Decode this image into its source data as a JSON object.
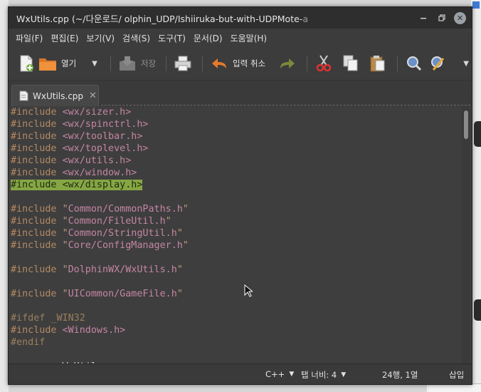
{
  "window": {
    "title_main": "WxUtils.cpp (~/다운로드/  olphin_UDP/Ishiiruka-but-with-UDPMote-",
    "title_fade": "a"
  },
  "menu": [
    "파일(F)",
    "편집(E)",
    "보기(V)",
    "검색(S)",
    "도구(T)",
    "문서(D)",
    "도움말(H)"
  ],
  "toolbar": {
    "open_label": "열기",
    "save_label": "저장",
    "undo_label": "입력 취소"
  },
  "tab": {
    "label": "WxUtils.cpp"
  },
  "code_lines": [
    {
      "type": "inc_angle",
      "kw": "#include",
      "path": "<wx/sizer.h>"
    },
    {
      "type": "inc_angle",
      "kw": "#include",
      "path": "<wx/spinctrl.h>"
    },
    {
      "type": "inc_angle",
      "kw": "#include",
      "path": "<wx/toolbar.h>"
    },
    {
      "type": "inc_angle",
      "kw": "#include",
      "path": "<wx/toplevel.h>"
    },
    {
      "type": "inc_angle",
      "kw": "#include",
      "path": "<wx/utils.h>"
    },
    {
      "type": "inc_angle",
      "kw": "#include",
      "path": "<wx/window.h>"
    },
    {
      "type": "inc_angle_hl",
      "kw": "#include",
      "path": "<wx/display.h>"
    },
    {
      "type": "blank"
    },
    {
      "type": "inc_quote",
      "kw": "#include",
      "path": "Common/CommonPaths.h"
    },
    {
      "type": "inc_quote",
      "kw": "#include",
      "path": "Common/FileUtil.h"
    },
    {
      "type": "inc_quote",
      "kw": "#include",
      "path": "Common/StringUtil.h"
    },
    {
      "type": "inc_quote",
      "kw": "#include",
      "path": "Core/ConfigManager.h"
    },
    {
      "type": "blank"
    },
    {
      "type": "inc_quote",
      "kw": "#include",
      "path": "DolphinWX/WxUtils.h"
    },
    {
      "type": "blank"
    },
    {
      "type": "inc_quote",
      "kw": "#include",
      "path": "UICommon/GameFile.h"
    },
    {
      "type": "blank"
    },
    {
      "type": "pp",
      "text": "#ifdef _WIN32"
    },
    {
      "type": "inc_angle",
      "kw": "#include",
      "path": "<Windows.h>"
    },
    {
      "type": "pp",
      "text": "#endif"
    },
    {
      "type": "blank"
    },
    {
      "type": "ns",
      "text": "         WxUtils"
    }
  ],
  "status": {
    "language": "C++",
    "tab_width": "탭 너비: 4",
    "position": "24행, 1열",
    "mode": "삽입"
  }
}
